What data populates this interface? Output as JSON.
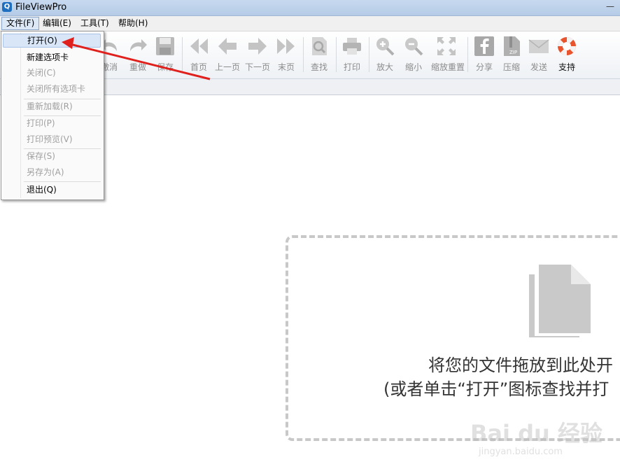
{
  "window": {
    "title": "FileViewPro",
    "app_icon": "magnifier-icon"
  },
  "menubar": {
    "items": [
      {
        "label": "文件(F)"
      },
      {
        "label": "编辑(E)"
      },
      {
        "label": "工具(T)"
      },
      {
        "label": "帮助(H)"
      }
    ]
  },
  "toolbar": {
    "buttons": [
      {
        "label": "撤消",
        "icon": "undo-icon",
        "enabled": false
      },
      {
        "label": "重做",
        "icon": "redo-icon",
        "enabled": false
      },
      {
        "label": "保存",
        "icon": "save-icon",
        "enabled": false
      },
      {
        "label": "首页",
        "icon": "first-page-icon",
        "enabled": false
      },
      {
        "label": "上一页",
        "icon": "prev-page-icon",
        "enabled": false
      },
      {
        "label": "下一页",
        "icon": "next-page-icon",
        "enabled": false
      },
      {
        "label": "末页",
        "icon": "last-page-icon",
        "enabled": false
      },
      {
        "label": "查找",
        "icon": "find-icon",
        "enabled": false
      },
      {
        "label": "打印",
        "icon": "print-icon",
        "enabled": false
      },
      {
        "label": "放大",
        "icon": "zoom-in-icon",
        "enabled": false
      },
      {
        "label": "缩小",
        "icon": "zoom-out-icon",
        "enabled": false
      },
      {
        "label": "缩放重置",
        "icon": "zoom-reset-icon",
        "enabled": false
      },
      {
        "label": "分享",
        "icon": "facebook-icon",
        "enabled": false
      },
      {
        "label": "压缩",
        "icon": "zip-icon",
        "enabled": false
      },
      {
        "label": "发送",
        "icon": "mail-icon",
        "enabled": false
      },
      {
        "label": "支持",
        "icon": "lifebuoy-icon",
        "enabled": true
      }
    ]
  },
  "file_menu": {
    "items": [
      {
        "label": "打开(O)",
        "enabled": true,
        "highlighted": true
      },
      {
        "label": "新建选项卡",
        "enabled": true
      },
      {
        "label": "关闭(C)",
        "enabled": false
      },
      {
        "label": "关闭所有选项卡",
        "enabled": false
      },
      {
        "label": "重新加载(R)",
        "enabled": false
      },
      {
        "label": "打印(P)",
        "enabled": false
      },
      {
        "label": "打印预览(V)",
        "enabled": false
      },
      {
        "label": "保存(S)",
        "enabled": false
      },
      {
        "label": "另存为(A)",
        "enabled": false
      },
      {
        "label": "退出(Q)",
        "enabled": true
      }
    ]
  },
  "dropzone": {
    "icon": "documents-icon",
    "line1": "将您的文件拖放到此处开",
    "line2": "(或者单击“打开”图标查找并打"
  },
  "watermark": {
    "main": "Bai du 经验",
    "sub": "jingyan.baidu.com"
  },
  "colors": {
    "annotation_arrow": "#e0201c",
    "highlight": "#d9e6f7",
    "disabled_text": "#a0a0a0"
  }
}
